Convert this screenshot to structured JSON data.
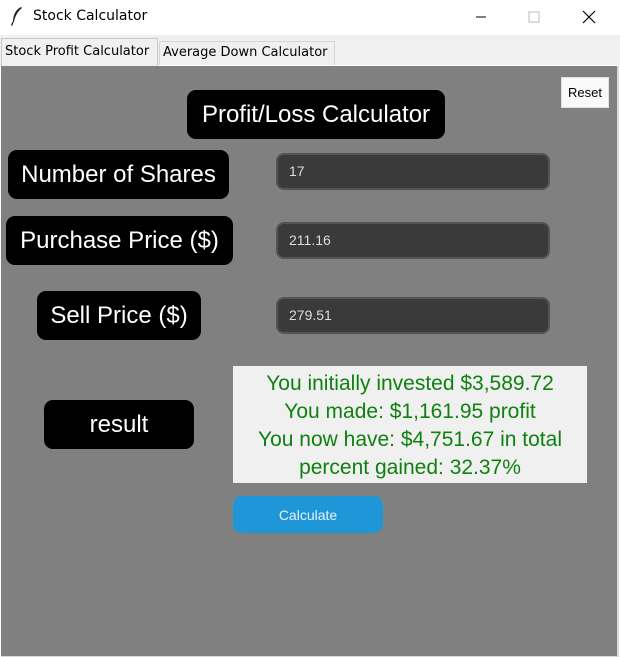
{
  "window": {
    "title": "Stock Calculator",
    "icons": {
      "app": "feather-icon",
      "minimize": "minimize-icon",
      "maximize": "maximize-icon",
      "close": "close-icon"
    }
  },
  "tabs": [
    {
      "label": "Stock Profit Calculator",
      "active": true
    },
    {
      "label": "Average Down Calculator",
      "active": false
    }
  ],
  "main": {
    "heading": "Profit/Loss Calculator",
    "reset_label": "Reset",
    "fields": {
      "shares": {
        "label": "Number of Shares",
        "value": "17"
      },
      "purchase": {
        "label": "Purchase Price ($)",
        "value": "211.16"
      },
      "sell": {
        "label": "Sell Price ($)",
        "value": "279.51"
      }
    },
    "result_label": "result",
    "result_lines": [
      "You initially invested $3,589.72",
      "You made: $1,161.95 profit",
      "You now have: $4,751.67 in total",
      "percent gained: 32.37%"
    ],
    "calculate_label": "Calculate"
  },
  "colors": {
    "panel_bg": "#808080",
    "label_bg": "#000000",
    "input_bg": "#3a3a3a",
    "result_text": "#108010",
    "calculate_bg": "#1f96d8"
  }
}
